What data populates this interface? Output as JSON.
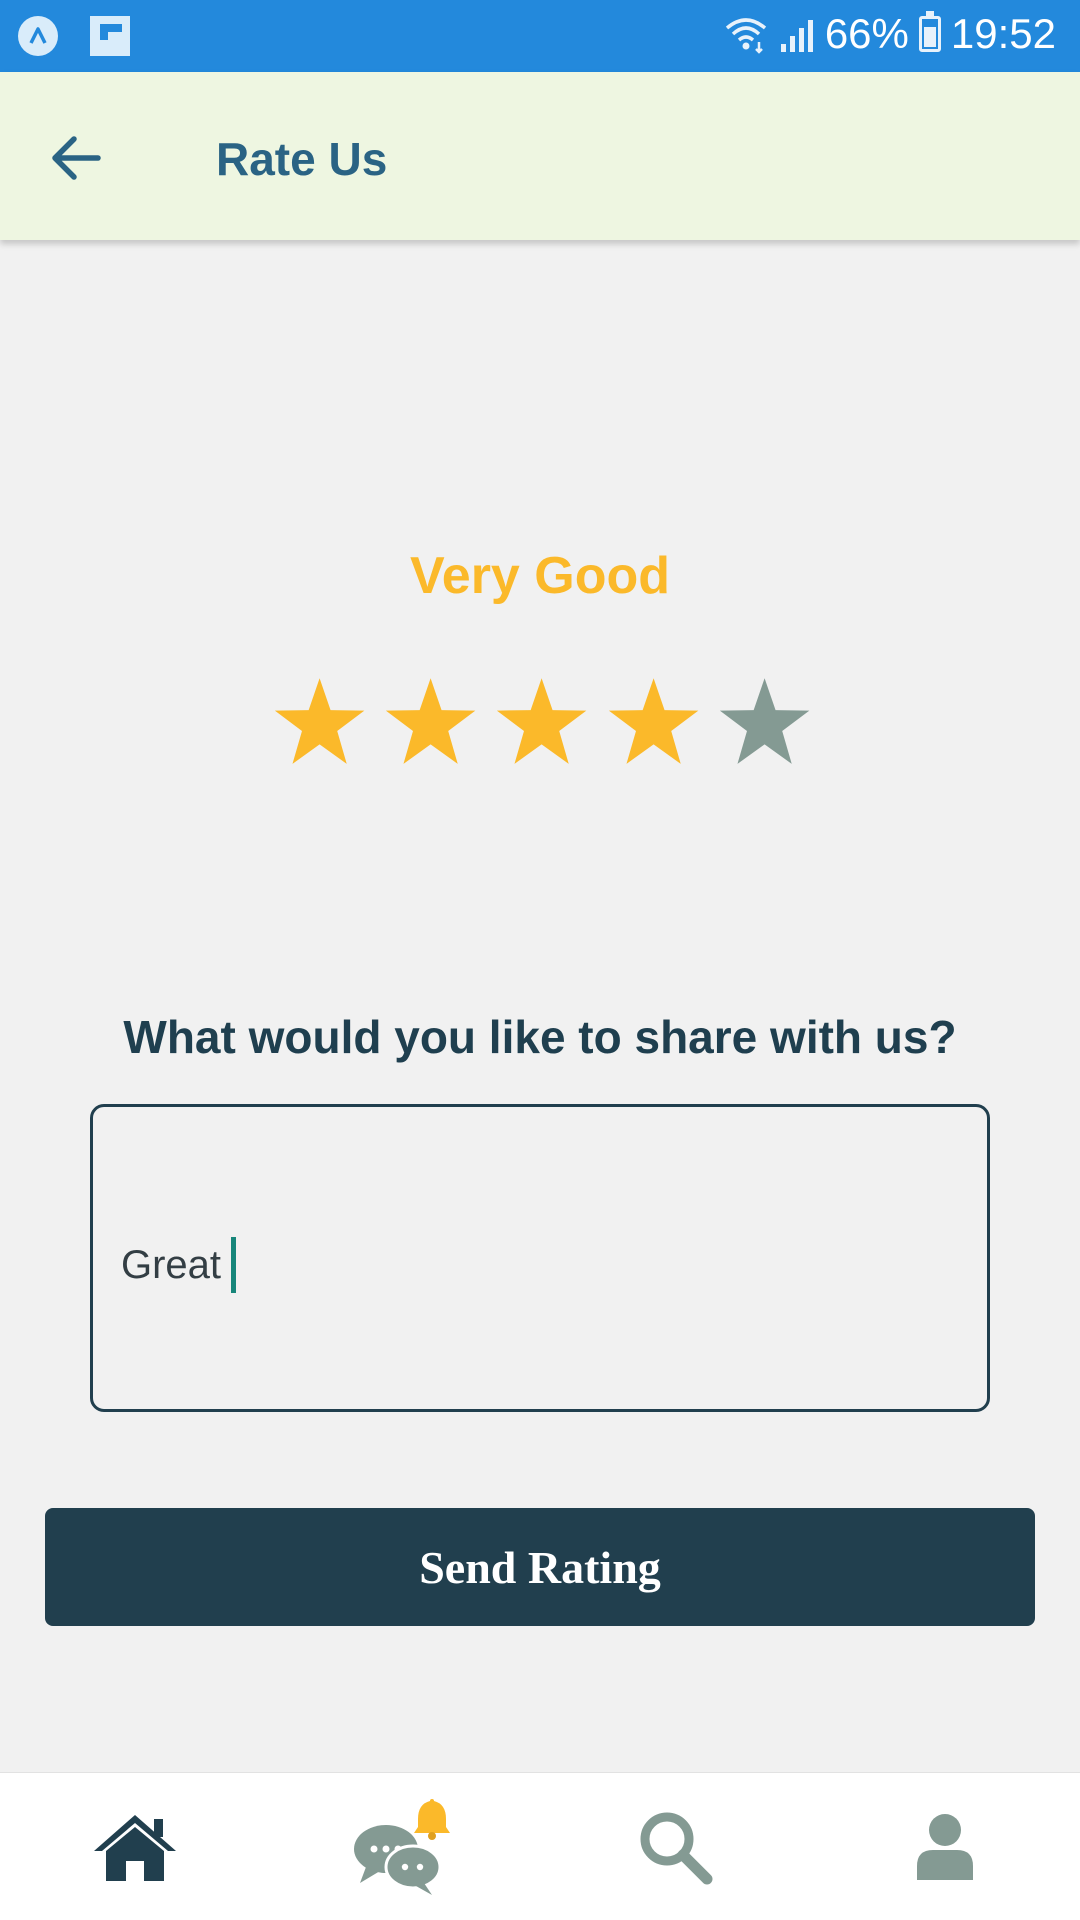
{
  "status_bar": {
    "battery": "66%",
    "time": "19:52",
    "icons": [
      "app-a-icon",
      "flipboard-icon",
      "wifi-icon",
      "signal-icon",
      "battery-icon"
    ]
  },
  "app_bar": {
    "title": "Rate Us",
    "back_icon": "arrow-left-icon"
  },
  "rating": {
    "label": "Very Good",
    "value": 4,
    "max": 5,
    "active_color": "#fbb92a",
    "inactive_color": "#849a93"
  },
  "feedback": {
    "question": "What would you like to share with us?",
    "value": "Great"
  },
  "send_button": {
    "label": "Send Rating"
  },
  "bottom_nav": {
    "items": [
      {
        "icon": "home-icon"
      },
      {
        "icon": "chat-notification-icon"
      },
      {
        "icon": "search-icon"
      },
      {
        "icon": "profile-icon"
      }
    ]
  },
  "colors": {
    "status_bar": "#2389dc",
    "app_bar": "#eef6e1",
    "primary_dark": "#213f4e",
    "title_blue": "#2a6384",
    "accent_yellow": "#fbb92a",
    "muted_gray": "#849a93"
  }
}
